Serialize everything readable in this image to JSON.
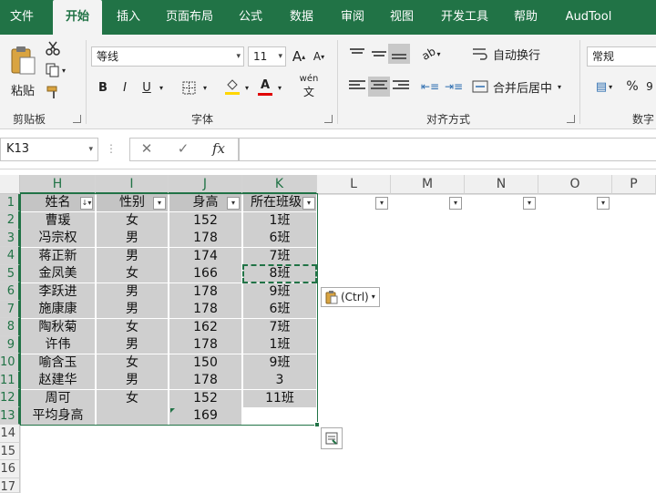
{
  "tabs": [
    "文件",
    "开始",
    "插入",
    "页面布局",
    "公式",
    "数据",
    "审阅",
    "视图",
    "开发工具",
    "帮助",
    "AudTool"
  ],
  "active_tab": "开始",
  "clipboard": {
    "paste_label": "粘贴",
    "group_label": "剪贴板"
  },
  "font": {
    "name": "等线",
    "size": "11",
    "group_label": "字体",
    "bold": "B",
    "italic": "I",
    "underline": "U",
    "grow": "A",
    "shrink": "A",
    "phonetic": "wén"
  },
  "alignment": {
    "wrap_label": "自动换行",
    "merge_label": "合并后居中",
    "group_label": "对齐方式"
  },
  "number": {
    "format": "常规",
    "percent": "%",
    "group_label": "数字"
  },
  "formula_bar": {
    "name_box": "K13",
    "cancel": "✕",
    "enter": "✓",
    "fx": "fx",
    "formula": ""
  },
  "columns": [
    "H",
    "I",
    "J",
    "K",
    "L",
    "M",
    "N",
    "O",
    "P"
  ],
  "rows": [
    "1",
    "2",
    "3",
    "4",
    "5",
    "6",
    "7",
    "8",
    "9",
    "10",
    "11",
    "12",
    "13",
    "14",
    "15",
    "16",
    "17"
  ],
  "table": {
    "headers": [
      "姓名",
      "性别",
      "身高",
      "所在班级"
    ],
    "rows": [
      [
        "曹瑗",
        "女",
        "152",
        "1班"
      ],
      [
        "冯宗权",
        "男",
        "178",
        "6班"
      ],
      [
        "蒋正新",
        "男",
        "174",
        "7班"
      ],
      [
        "金凤美",
        "女",
        "166",
        "8班"
      ],
      [
        "李跃进",
        "男",
        "178",
        "9班"
      ],
      [
        "施康康",
        "男",
        "178",
        "6班"
      ],
      [
        "陶秋菊",
        "女",
        "162",
        "7班"
      ],
      [
        "许伟",
        "男",
        "178",
        "1班"
      ],
      [
        "喻含玉",
        "女",
        "150",
        "9班"
      ],
      [
        "赵建华",
        "男",
        "178",
        "3"
      ],
      [
        "周可",
        "女",
        "152",
        "11班"
      ]
    ],
    "summary": [
      "平均身高",
      "",
      "169",
      ""
    ]
  },
  "paste_options": {
    "label": "(Ctrl)"
  },
  "colors": {
    "accent": "#217346",
    "header_fill": "#c4c4c4",
    "data_fill": "#cfcfcf"
  }
}
